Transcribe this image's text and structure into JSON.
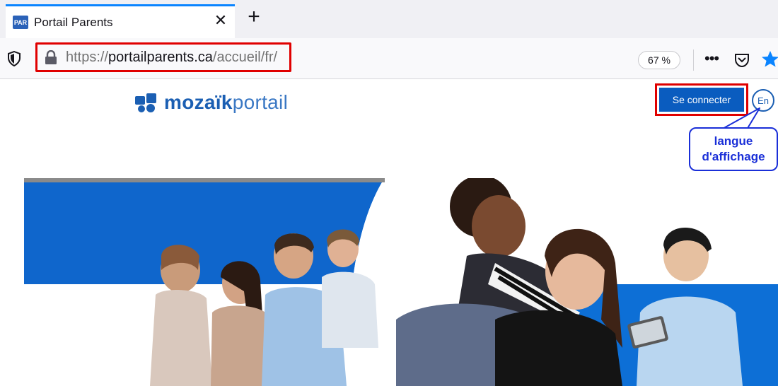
{
  "browser": {
    "tab": {
      "favicon_text": "PAR",
      "title": "Portail Parents",
      "close_glyph": "✕"
    },
    "new_tab_glyph": "+",
    "address": {
      "scheme": "https://",
      "host": "portailparents.ca",
      "path": "/accueil/fr/"
    },
    "zoom": "67 %",
    "icons": [
      "shield-icon",
      "lock-icon",
      "more-icon",
      "pocket-icon",
      "star-icon"
    ]
  },
  "page": {
    "logo": {
      "bold": "mozaïk",
      "light": "portail"
    },
    "connect_label": "Se connecter",
    "language_label": "En",
    "callout": {
      "line1": "langue",
      "line2": "d'affichage"
    }
  },
  "colors": {
    "brand_blue": "#0a5cbf",
    "highlight_red": "#e00000",
    "callout_blue": "#1a2fd8"
  }
}
